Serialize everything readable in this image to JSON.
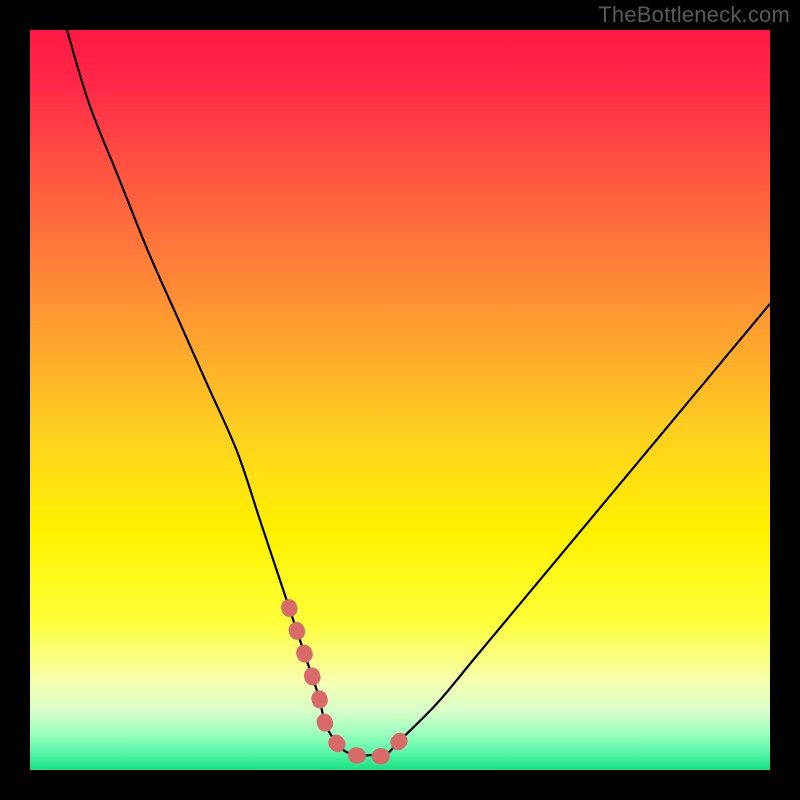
{
  "watermark": "TheBottleneck.com",
  "chart_data": {
    "type": "line",
    "title": "",
    "xlabel": "",
    "ylabel": "",
    "xlim": [
      0,
      100
    ],
    "ylim": [
      0,
      100
    ],
    "grid": false,
    "legend": false,
    "series": [
      {
        "name": "bottleneck-curve",
        "x": [
          5,
          8,
          12,
          16,
          20,
          24,
          28,
          31,
          33,
          35,
          37,
          39,
          40,
          42,
          44,
          46,
          48,
          50,
          55,
          60,
          65,
          70,
          75,
          80,
          85,
          90,
          95,
          100
        ],
        "y": [
          100,
          90,
          80,
          70,
          61,
          52,
          43,
          34,
          28,
          22,
          16,
          10,
          6,
          3,
          2,
          2,
          2,
          4,
          9,
          15,
          21,
          27,
          33,
          39,
          45,
          51,
          57,
          63
        ]
      }
    ],
    "highlight_segment": {
      "name": "optimal-range",
      "x": [
        35,
        37,
        39,
        40,
        42,
        44,
        46,
        48,
        50
      ],
      "y": [
        22,
        16,
        10,
        6,
        3,
        2,
        2,
        2,
        4
      ]
    },
    "background_gradient": {
      "top_color": "#ff1744",
      "mid_color": "#ffea00",
      "bottom_color": "#00e676"
    }
  }
}
